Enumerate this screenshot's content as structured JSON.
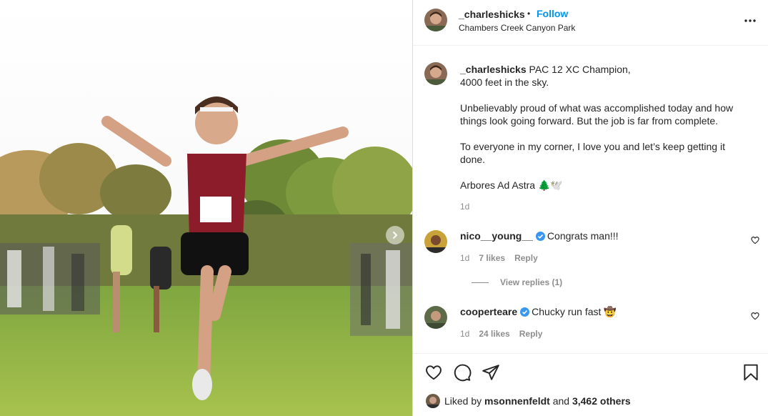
{
  "post": {
    "username": "_charleshicks",
    "separator": "•",
    "follow_label": "Follow",
    "location": "Chambers Creek Canyon Park"
  },
  "caption": {
    "username": "_charleshicks",
    "line1": "PAC 12 XC Champion,",
    "line2": "4000 feet in the sky.",
    "para2_line1": "Unbelievably proud of what was accomplished today and how",
    "para2_line2": "things look going forward. But the job is far from complete.",
    "para3_line1": "To everyone in my corner, I love you and let’s keep getting it",
    "para3_line2": "done.",
    "para4": "Arbores Ad Astra 🌲🕊️",
    "time": "1d"
  },
  "comments": [
    {
      "username": "nico__young__",
      "text": "Congrats man!!!",
      "time": "1d",
      "likes": "7 likes",
      "reply_label": "Reply"
    },
    {
      "username": "cooperteare",
      "text": "Chucky run fast 🤠",
      "time": "1d",
      "likes": "24 likes",
      "reply_label": "Reply"
    }
  ],
  "view_replies": "View replies (1)",
  "likes_summary": {
    "prefix": "Liked by",
    "user": "msonnenfeldt",
    "connector": "and",
    "count": "3,462 others"
  },
  "icons": {
    "more": "more-options-icon",
    "next": "chevron-right-icon",
    "like": "heart-icon",
    "comment": "comment-icon",
    "share": "share-icon",
    "save": "bookmark-icon",
    "verified": "verified-badge-icon"
  },
  "colors": {
    "follow": "#0095f6",
    "verified": "#3897f0",
    "muted": "#8e8e8e",
    "text": "#262626"
  }
}
